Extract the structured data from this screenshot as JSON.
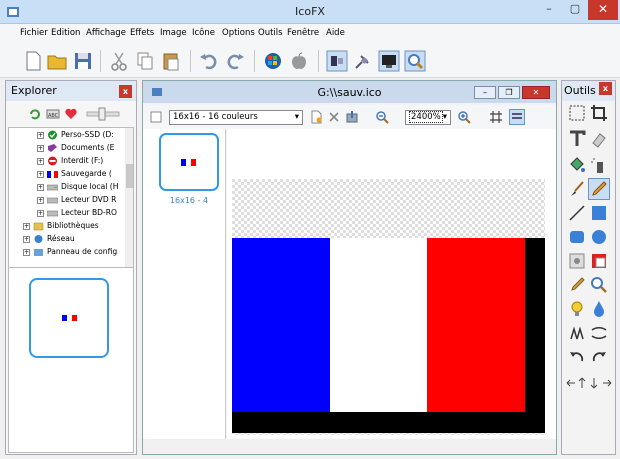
{
  "window": {
    "title": "IcoFX",
    "minimize": "–",
    "maximize": "▢",
    "close": "✕"
  },
  "menu": [
    "Fichier",
    "Edition",
    "Affichage",
    "Effets",
    "Image",
    "Icône",
    "Options",
    "Outils",
    "Fenêtre",
    "Aide"
  ],
  "explorer": {
    "title": "Explorer",
    "close": "x",
    "tree": [
      {
        "label": "Perso-SSD (D:",
        "icon": "check-drive-icon"
      },
      {
        "label": "Documents (E",
        "icon": "documents-drive-icon"
      },
      {
        "label": "Interdit (F:)",
        "icon": "forbidden-drive-icon"
      },
      {
        "label": "Sauvegarde (",
        "icon": "flag-drive-icon"
      },
      {
        "label": "Disque local (H",
        "icon": "local-disk-icon"
      },
      {
        "label": "Lecteur DVD R",
        "icon": "dvd-drive-icon"
      },
      {
        "label": "Lecteur BD-RO",
        "icon": "bd-drive-icon"
      },
      {
        "label": "Bibliothèques",
        "icon": "libraries-icon"
      },
      {
        "label": "Réseau",
        "icon": "network-icon"
      },
      {
        "label": "Panneau de config",
        "icon": "control-panel-icon"
      }
    ]
  },
  "document": {
    "title": "G:\\\\sauv.ico",
    "format_select": "16x16 - 16 couleurs",
    "zoom": "2400%",
    "format_label": "16x16 - 4",
    "controls": {
      "min": "–",
      "restore": "❐",
      "close": "✕"
    }
  },
  "tools": {
    "title": "Outils",
    "close": "x"
  },
  "colors": {
    "blue": "#0000ff",
    "white": "#ffffff",
    "red": "#ff0000",
    "black": "#000000",
    "accent": "#3399e6"
  }
}
